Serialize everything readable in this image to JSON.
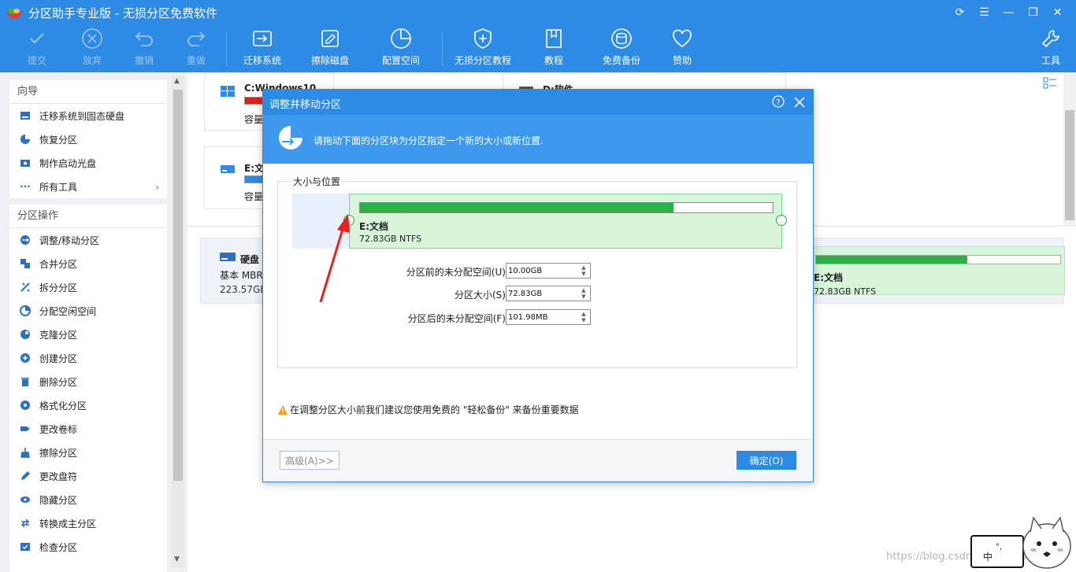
{
  "app": {
    "title": "分区助手专业版 - 无损分区免费软件"
  },
  "toolbar": {
    "submit": "提交",
    "discard": "放弃",
    "undo": "撤销",
    "redo": "重做",
    "migrate_os": "迁移系统",
    "wipe_disk": "擦除磁盘",
    "config_space": "配置空间",
    "tutorial_lossless": "无损分区教程",
    "tutorial": "教程",
    "free_backup": "免费备份",
    "sponsor": "赞助",
    "tools": "工具"
  },
  "sidebar": {
    "wizard": {
      "title": "向导",
      "items": [
        {
          "label": "迁移系统到固态硬盘",
          "icon": "ssd-icon"
        },
        {
          "label": "恢复分区",
          "icon": "pie-icon"
        },
        {
          "label": "制作启动光盘",
          "icon": "disc-icon"
        },
        {
          "label": "所有工具",
          "icon": "dots-icon"
        }
      ]
    },
    "operations": {
      "title": "分区操作",
      "items": [
        {
          "label": "调整/移动分区"
        },
        {
          "label": "合并分区"
        },
        {
          "label": "拆分分区"
        },
        {
          "label": "分配空闲空间"
        },
        {
          "label": "克隆分区"
        },
        {
          "label": "创建分区"
        },
        {
          "label": "删除分区"
        },
        {
          "label": "格式化分区"
        },
        {
          "label": "更改卷标"
        },
        {
          "label": "擦除分区"
        },
        {
          "label": "更改盘符"
        },
        {
          "label": "隐藏分区"
        },
        {
          "label": "转换成主分区"
        },
        {
          "label": "检查分区"
        }
      ]
    }
  },
  "partitions": {
    "c": {
      "name": "C:Windows10",
      "cap_label": "容量"
    },
    "d": {
      "name": "D:软件"
    },
    "e": {
      "name": "E:文档",
      "cap_label": "容量"
    }
  },
  "disk": {
    "name": "硬盘 1",
    "type": "基本 MBR",
    "size": "223.57GB",
    "part_name": "E:文档",
    "part_fs": "72.83GB NTFS",
    "usage": 0.62
  },
  "dialog": {
    "title": "调整并移动分区",
    "banner": "请拖动下面的分区块为分区指定一个新的大小或新位置.",
    "group_label": "大小与位置",
    "partition": {
      "name": "E:文档",
      "fs": "72.83GB NTFS",
      "usage": 0.76
    },
    "fields": [
      {
        "label": "分区前的未分配空间(U):",
        "value": "10.00GB"
      },
      {
        "label": "分区大小(S):",
        "value": "72.83GB"
      },
      {
        "label": "分区后的未分配空间(F):",
        "value": "101.98MB"
      }
    ],
    "warning": "在调整分区大小前我们建议您使用免费的 \"轻松备份\" 来备份重要数据",
    "advanced": "高级(A)>>",
    "ok": "确定(O)"
  },
  "ime": {
    "mode": "中"
  },
  "watermark": "https://blog.csdn.net/qq_40..."
}
